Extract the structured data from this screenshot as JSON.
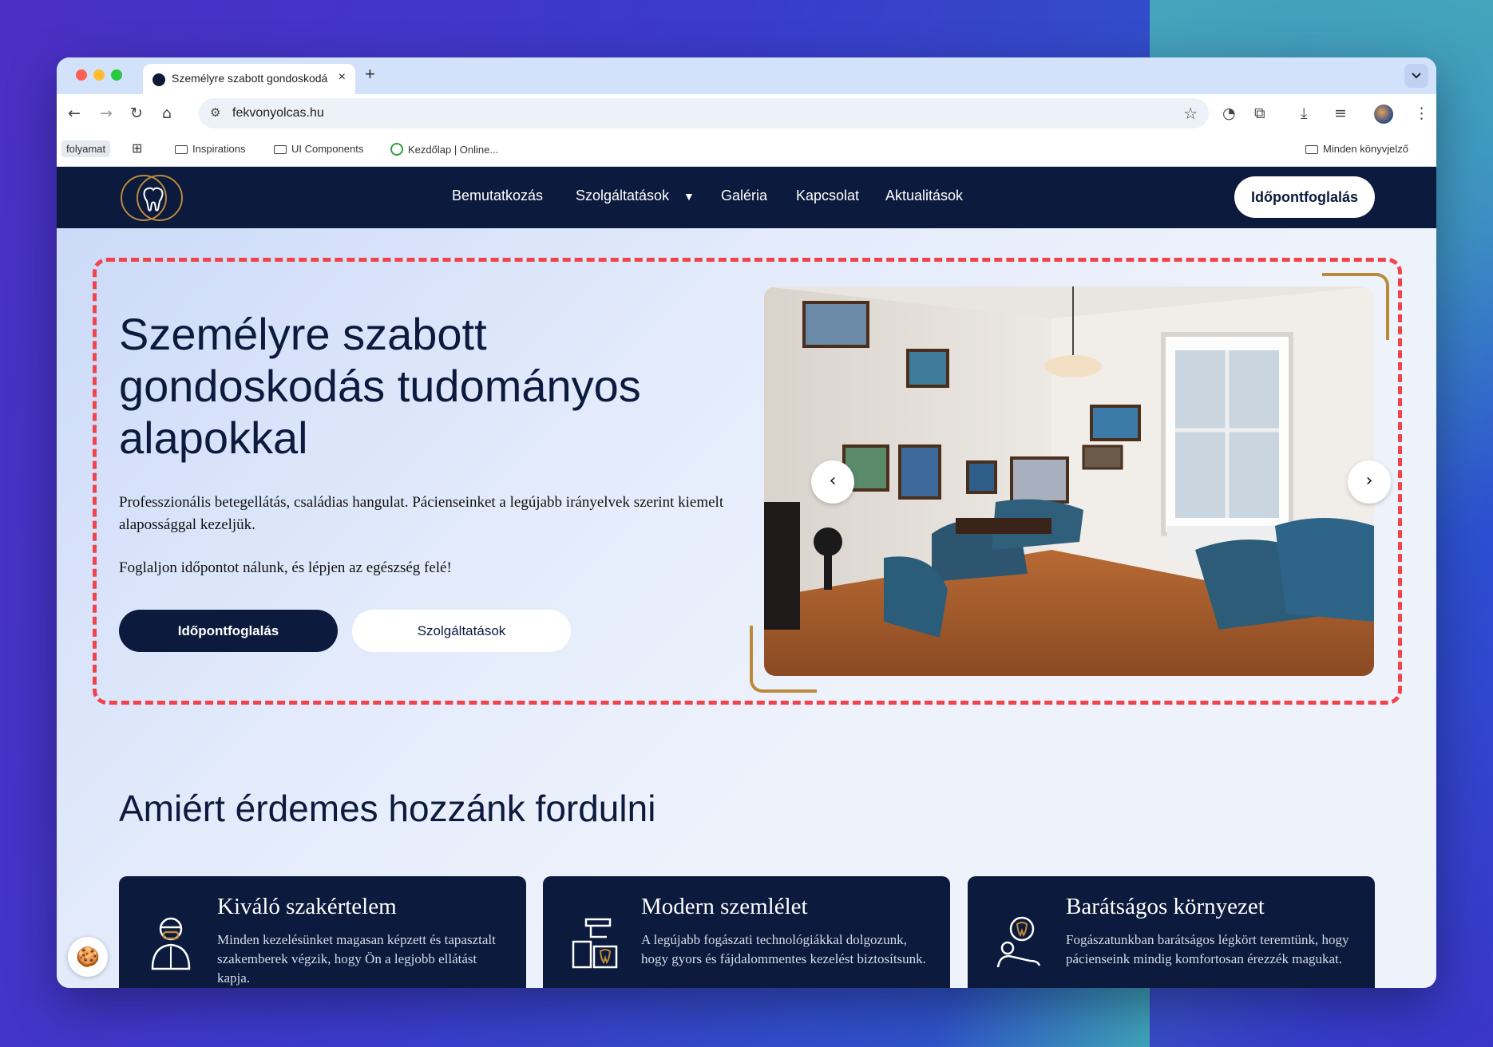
{
  "browser": {
    "tab_title": "Személyre szabott gondoskodás",
    "tab_close": "×",
    "new_tab": "+",
    "tab_menu": "⌄",
    "url": "fekvonyolcas.hu",
    "bookmarks": {
      "chip": "folyamat",
      "items": [
        "Inspirations",
        "UI Components",
        "Kezdőlap | Online..."
      ],
      "all": "Minden könyvjelző"
    },
    "colors": {
      "close": "#ff5f57",
      "minimize": "#febc2e",
      "zoom": "#28c840"
    }
  },
  "nav": {
    "links": [
      "Bemutatkozás",
      "Szolgáltatások",
      "Galéria",
      "Kapcsolat",
      "Aktualitások"
    ],
    "dropdown_caret": "▼",
    "cta": "Időpontfoglalás"
  },
  "hero": {
    "title": "Személyre szabott gondoskodás tudományos alapokkal",
    "text1": "Professzionális betegellátás, családias hangulat. Pácienseinket a legújabb irányelvek szerint kiemelt alapossággal kezeljük.",
    "text2": "Foglaljon időpontot nálunk, és lépjen az egészség felé!",
    "btn_primary": "Időpontfoglalás",
    "btn_secondary": "Szolgáltatások",
    "prev": "‹",
    "next": "›"
  },
  "why": {
    "title": "Amiért érdemes hozzánk fordulni",
    "cards": [
      {
        "title": "Kiváló szakértelem",
        "text": "Minden kezelésünket magasan képzett és tapasztalt szakemberek végzik, hogy Ön a legjobb ellátást kapja."
      },
      {
        "title": "Modern szemlélet",
        "text": "A legújabb fogászati technológiákkal dolgozunk, hogy gyors és fájdalommentes kezelést biztosítsunk."
      },
      {
        "title": "Barátságos környezet",
        "text": "Fogászatunkban barátságos légkört teremtünk, hogy pácienseink mindig komfortosan érezzék magukat."
      }
    ]
  },
  "theme": {
    "navy": "#0b1a3d",
    "gold": "#b98a3a",
    "highlight": "#f0434c"
  }
}
